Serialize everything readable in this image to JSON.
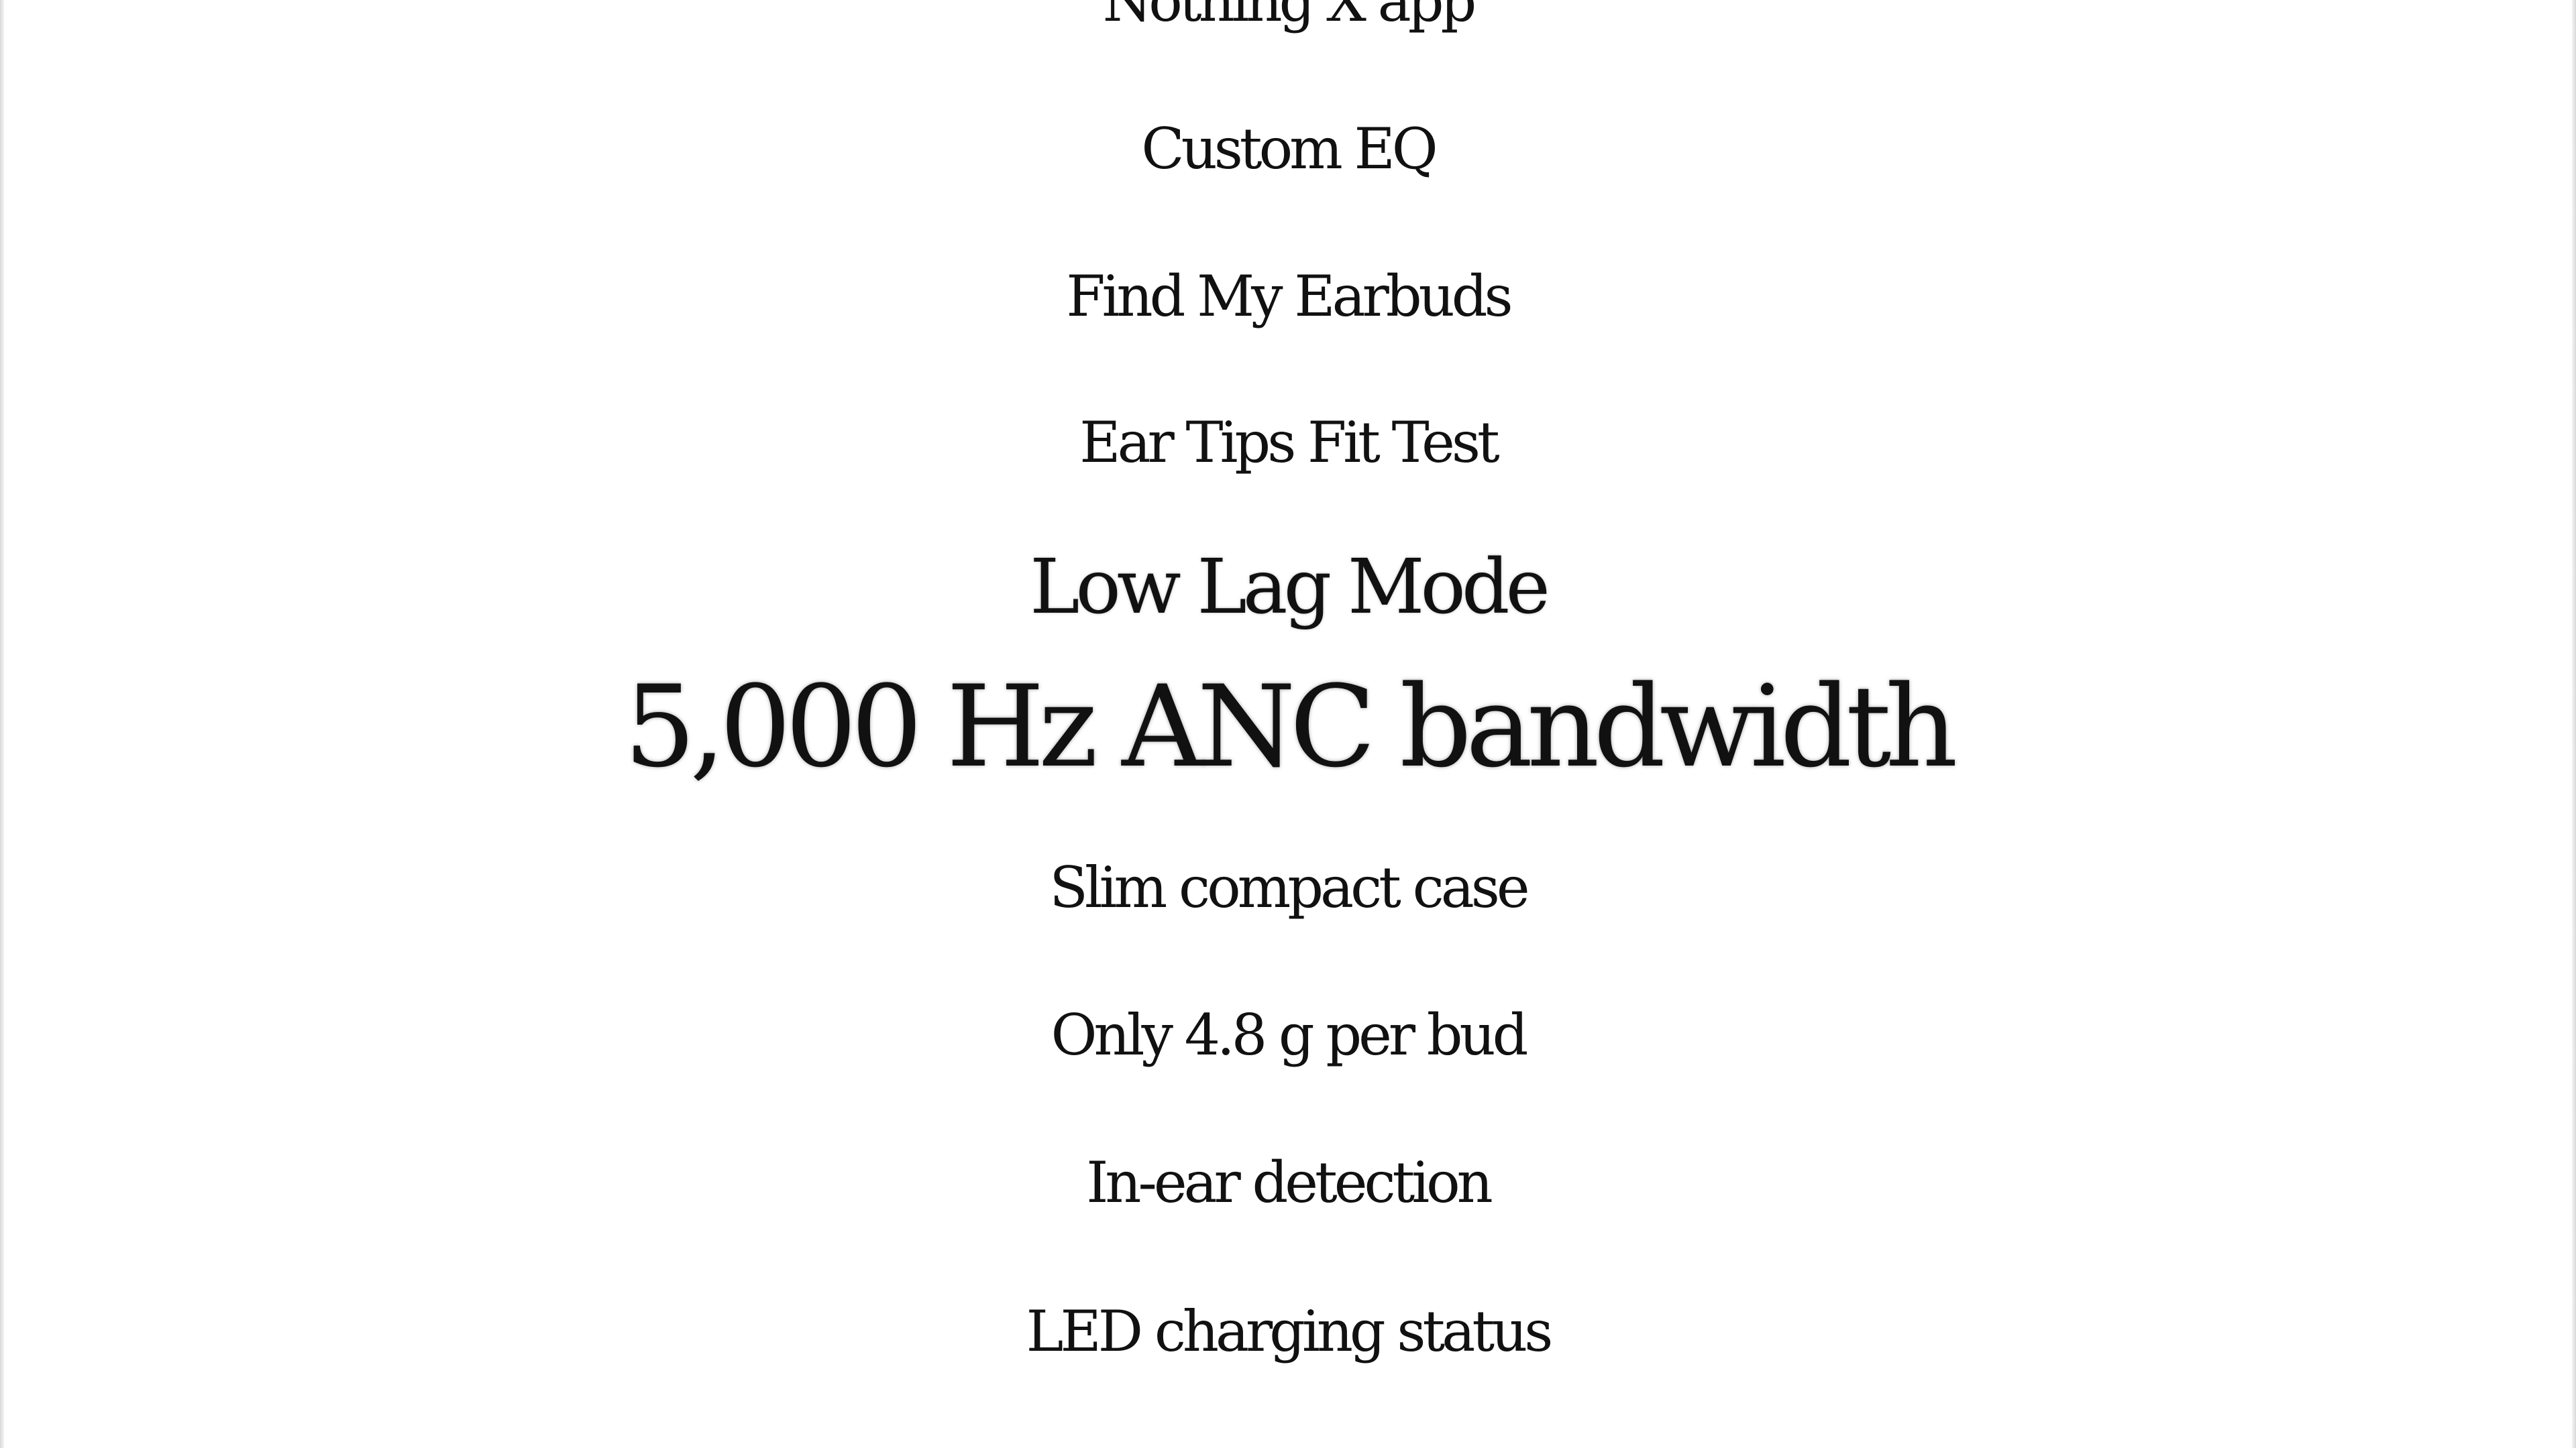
{
  "features": [
    "Nothing X app",
    "Custom EQ",
    "Find My Earbuds",
    "Ear Tips Fit Test",
    "Low Lag Mode",
    "5,000 Hz ANC bandwidth",
    "Slim compact case",
    "Only 4.8 g per bud",
    "In-ear detection",
    "LED charging status"
  ]
}
